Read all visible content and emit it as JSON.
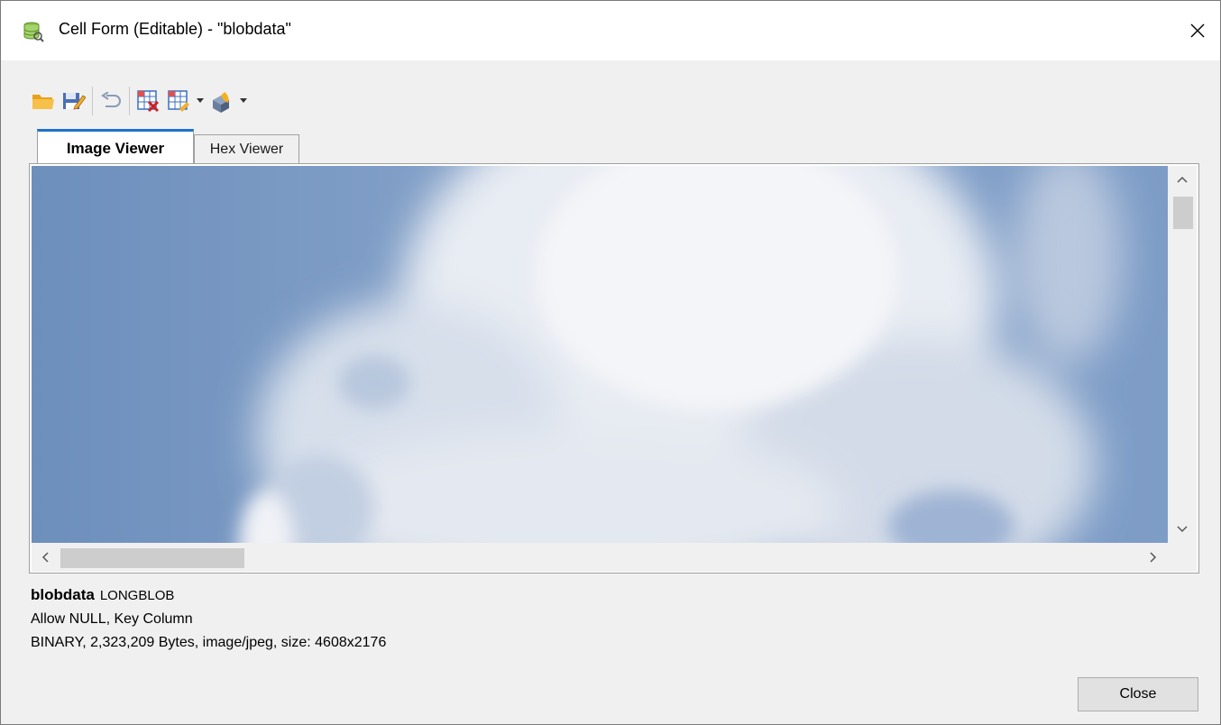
{
  "window": {
    "title": "Cell Form (Editable) - \"blobdata\"",
    "icon": "database-cell-icon"
  },
  "toolbar": {
    "buttons": [
      "open-folder-icon",
      "save-edit-icon",
      "undo-icon",
      "clear-grid-icon",
      "grid-options-icon",
      "color-object-icon"
    ]
  },
  "tabs": [
    {
      "label": "Image Viewer",
      "active": true
    },
    {
      "label": "Hex Viewer",
      "active": false
    }
  ],
  "image": {
    "description_colors": {
      "sky": "#6e90bd",
      "cloud": "#eef0f5"
    }
  },
  "info": {
    "column_name": "blobdata",
    "column_type": "LONGBLOB",
    "attributes": "Allow NULL, Key Column",
    "details": "BINARY, 2,323,209 Bytes, image/jpeg, size: 4608x2176"
  },
  "buttons": {
    "close": "Close"
  },
  "colors": {
    "accent": "#1e73c8",
    "window_bg": "#f0f0f0"
  }
}
